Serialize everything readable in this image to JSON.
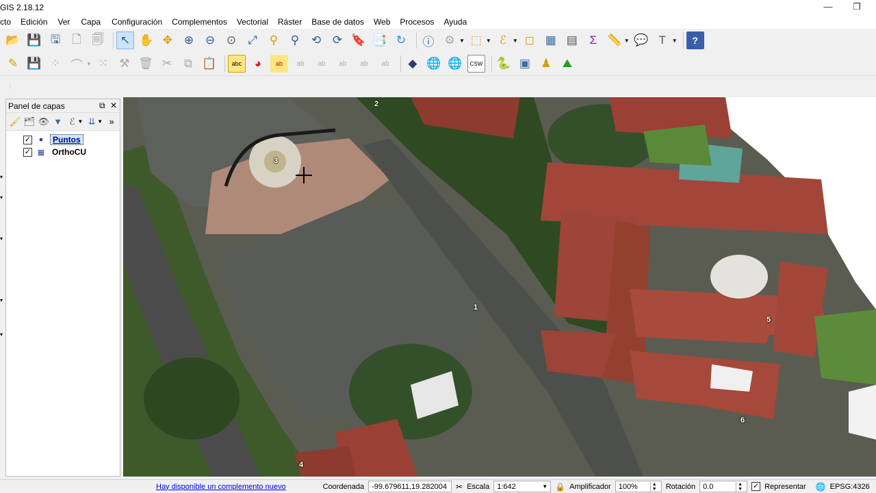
{
  "app": {
    "title": "GIS 2.18.12"
  },
  "menu": [
    "cto",
    "Edición",
    "Ver",
    "Capa",
    "Configuración",
    "Complementos",
    "Vectorial",
    "Ráster",
    "Base de datos",
    "Web",
    "Procesos",
    "Ayuda"
  ],
  "toolbar1": [
    "open-folder-icon",
    "save-icon",
    "save-as-icon",
    "new-print-composer-icon",
    "composer-manager-icon",
    "pan-selection-icon",
    "pan-hand-icon",
    "pan-to-selection-icon",
    "zoom-in-icon",
    "zoom-out-icon",
    "zoom-native-icon",
    "zoom-full-icon",
    "zoom-to-selection-icon",
    "zoom-to-layer-icon",
    "zoom-last-icon",
    "zoom-next-icon",
    "new-bookmark-icon",
    "show-bookmarks-icon",
    "refresh-icon",
    "identify-icon",
    "measure-icon",
    "select-features-icon",
    "select-expression-icon",
    "deselect-icon",
    "attribute-table-icon",
    "field-calculator-icon",
    "statistics-icon",
    "measure-line-icon",
    "map-tips-icon",
    "text-annotation-icon",
    "help-icon"
  ],
  "toolbar2": [
    "edit-pencil-icon",
    "save-edits-icon",
    "add-point-icon",
    "add-line-icon",
    "add-feature-icon",
    "node-tool-icon",
    "delete-icon",
    "cut-icon",
    "copy-icon",
    "paste-icon",
    "label-abc-icon",
    "diagram-icon",
    "highlight-label-icon",
    "pin-label-icon",
    "show-hide-label-icon",
    "move-label-icon",
    "rotate-label-icon",
    "change-label-icon",
    "openlayers-icon",
    "wms-icon",
    "wfs-icon",
    "csw-icon",
    "python-icon",
    "georeferencer-icon",
    "gps-icon",
    "terrain-icon"
  ],
  "layers_panel": {
    "title": "Panel de capas",
    "layers": [
      {
        "name": "Puntos",
        "checked": true,
        "selected": true,
        "icon": "point-layer-icon"
      },
      {
        "name": "OrthoCU",
        "checked": true,
        "selected": false,
        "icon": "raster-layer-icon"
      }
    ]
  },
  "map_points": [
    "2",
    "3",
    "1",
    "5",
    "6",
    "4"
  ],
  "status": {
    "plugin_link": "Hay disponible un complemento nuevo",
    "coord_label": "Coordenada",
    "coord_value": "-99.679611,19.282004",
    "scale_label": "Escala",
    "scale_value": "1:642",
    "magnifier_label": "Amplificador",
    "magnifier_value": "100%",
    "rotation_label": "Rotación",
    "rotation_value": "0.0",
    "render_label": "Representar",
    "render_checked": true,
    "crs": "EPSG:4326"
  }
}
